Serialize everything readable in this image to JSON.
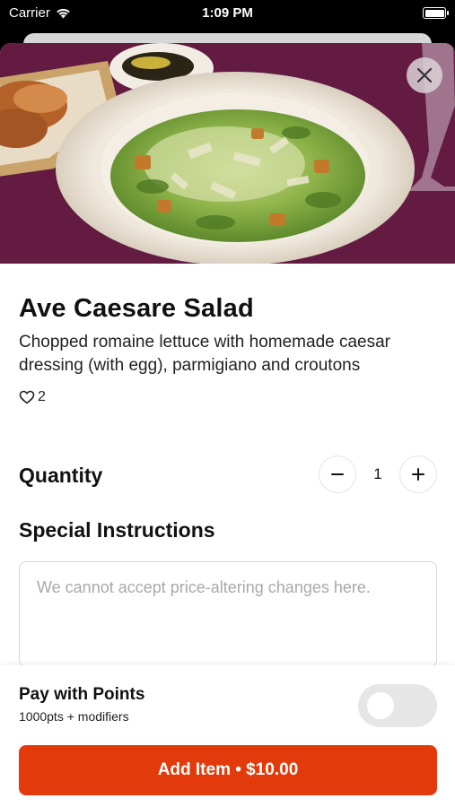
{
  "status_bar": {
    "carrier": "Carrier",
    "time": "1:09 PM"
  },
  "item": {
    "name": "Ave Caesare Salad",
    "description": "Chopped romaine lettuce with homemade caesar dressing (with egg), parmigiano and croutons",
    "likes": "2",
    "image_icon": "salad-photo"
  },
  "quantity": {
    "label": "Quantity",
    "value": "1",
    "decrement_icon": "minus-icon",
    "increment_icon": "plus-icon"
  },
  "special_instructions": {
    "label": "Special Instructions",
    "value": "",
    "placeholder": "We cannot accept price-altering changes here."
  },
  "points": {
    "title": "Pay with Points",
    "subtitle": "1000pts + modifiers",
    "enabled": false
  },
  "add_button": {
    "label": "Add Item • $10.00"
  },
  "colors": {
    "accent": "#e33a0c",
    "tablecloth": "#6b1f48"
  }
}
